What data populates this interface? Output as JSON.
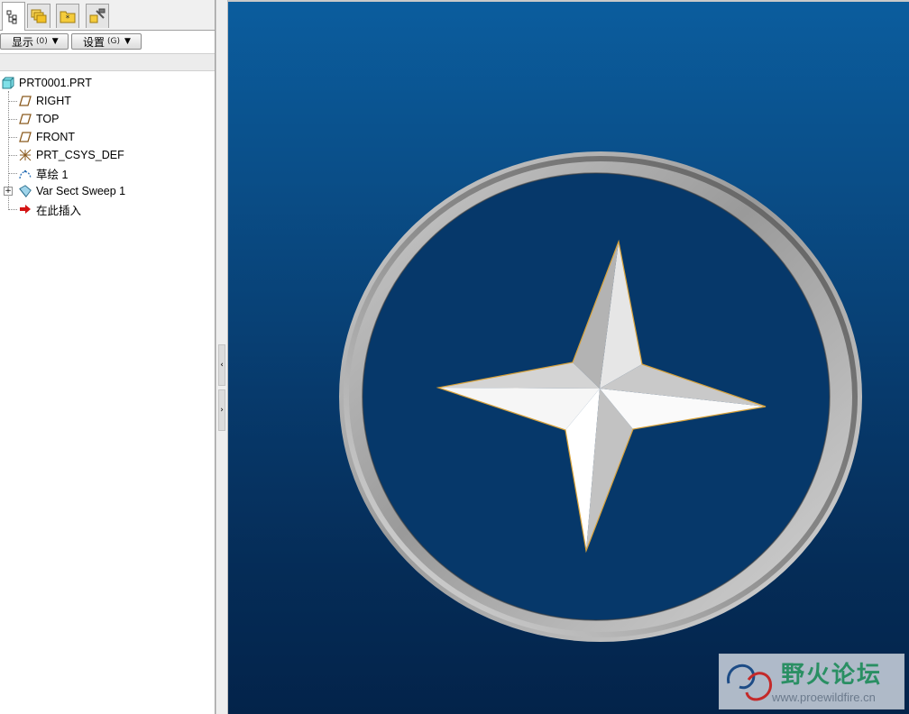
{
  "toolbar": {
    "show_label": "显示",
    "show_hotkey": "(0)",
    "settings_label": "设置",
    "settings_hotkey": "(G)"
  },
  "model_tree": {
    "root": "PRT0001.PRT",
    "items": [
      {
        "label": "RIGHT",
        "icon": "datum-plane-icon"
      },
      {
        "label": "TOP",
        "icon": "datum-plane-icon"
      },
      {
        "label": "FRONT",
        "icon": "datum-plane-icon"
      },
      {
        "label": "PRT_CSYS_DEF",
        "icon": "coordinate-system-icon"
      },
      {
        "label": "草绘 1",
        "icon": "sketch-icon"
      },
      {
        "label": "Var Sect Sweep 1",
        "icon": "sweep-feature-icon",
        "expandable": true
      },
      {
        "label": "在此插入",
        "icon": "insert-here-arrow-icon"
      }
    ]
  },
  "watermark": {
    "title": "野火论坛",
    "url": "www.proewildfire.cn"
  },
  "colors": {
    "viewport_top": "#0b5d9e",
    "viewport_bottom": "#03234a",
    "watermark_green": "#2a8f63"
  }
}
